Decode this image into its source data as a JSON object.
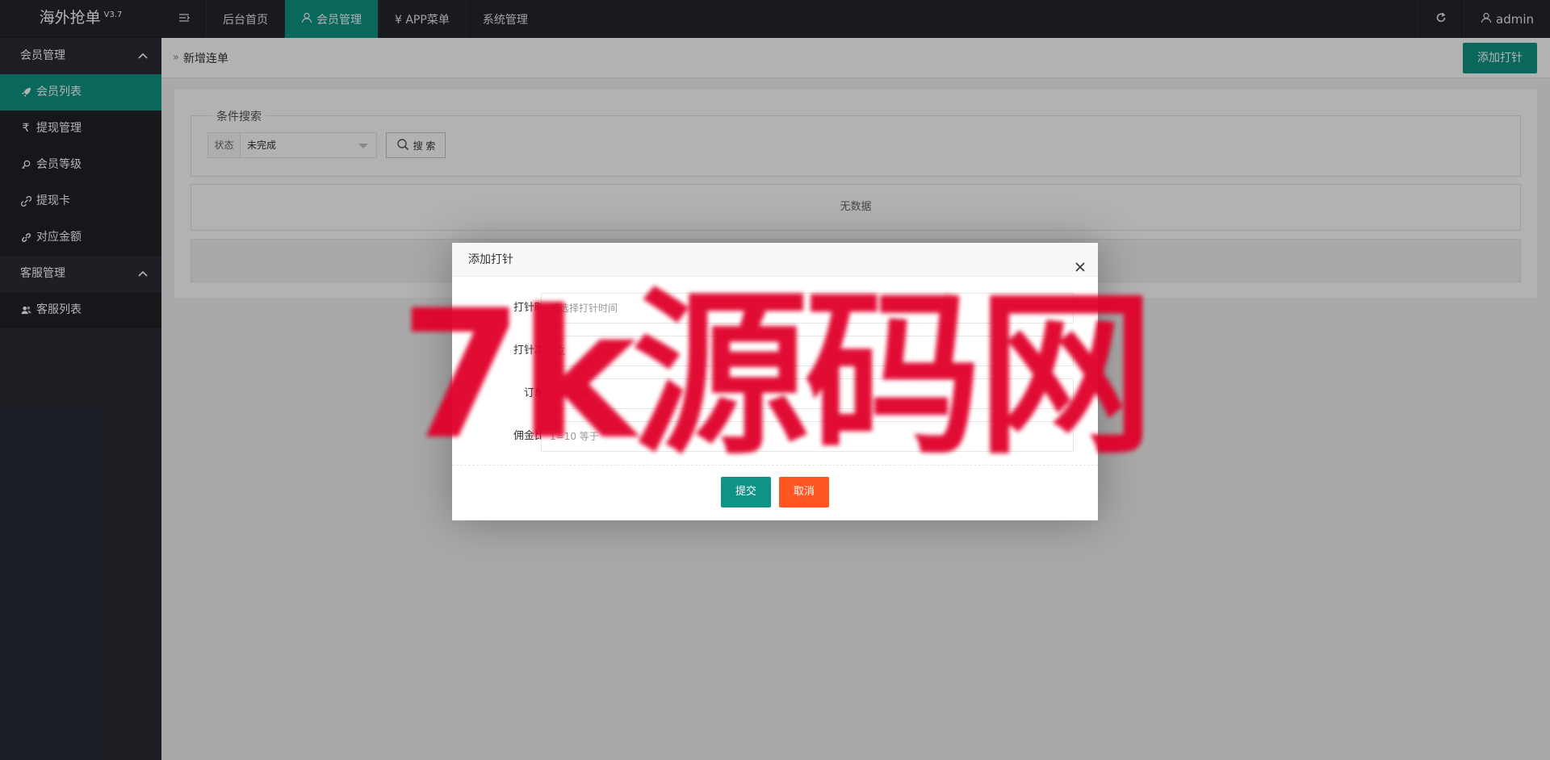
{
  "app": {
    "title": "海外抢单",
    "version": "V3.7"
  },
  "sidebar": {
    "groups": [
      {
        "label": "会员管理",
        "items": [
          {
            "label": "会员列表",
            "icon": "rocket-icon",
            "active": true
          },
          {
            "label": "提现管理",
            "icon": "rupee-icon"
          },
          {
            "label": "会员等级",
            "icon": "key-icon"
          },
          {
            "label": "提现卡",
            "icon": "link-icon"
          },
          {
            "label": "对应金额",
            "icon": "chain-icon"
          }
        ]
      },
      {
        "label": "客服管理",
        "items": [
          {
            "label": "客服列表",
            "icon": "users-icon"
          }
        ]
      }
    ]
  },
  "topbar": {
    "menu_icon": "menu-toggle-icon",
    "tabs": [
      {
        "label": "后台首页"
      },
      {
        "label": "会员管理",
        "icon": "user-icon",
        "active": true
      },
      {
        "label": "¥ APP菜单"
      },
      {
        "label": "系统管理"
      }
    ],
    "refresh_icon": "refresh-icon",
    "user": "admin"
  },
  "page": {
    "breadcrumb": "新增连单",
    "add_button": "添加打针",
    "search": {
      "legend": "条件搜索",
      "status_label": "状态",
      "status_value": "未完成",
      "search_button": "搜 索"
    },
    "empty_text": "无数据"
  },
  "modal": {
    "title": "添加打针",
    "fields": [
      {
        "label": "打针时",
        "placeholder": "请选择打针时间"
      },
      {
        "label": "打针次",
        "placeholder": "0立"
      },
      {
        "label": "订单",
        "placeholder": "打针金额"
      },
      {
        "label": "佣金比",
        "placeholder": "1=10 等于"
      }
    ],
    "submit": "提交",
    "cancel": "取消"
  },
  "watermark": "7k源码网",
  "colors": {
    "accent": "#0e9485",
    "danger": "#ff5722",
    "sidebar": "#2a2d36",
    "header": "#23262e"
  }
}
